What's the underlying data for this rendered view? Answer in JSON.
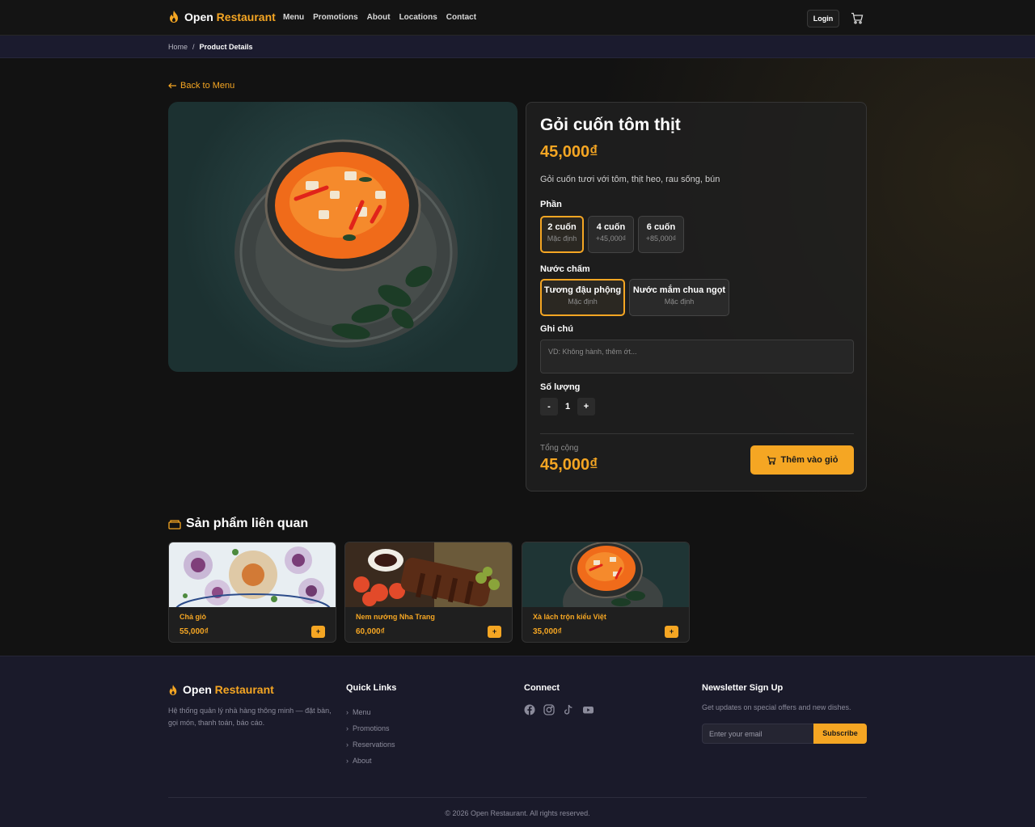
{
  "header": {
    "brand_part1": "Open",
    "brand_part2": "Restaurant",
    "nav": [
      "Menu",
      "Promotions",
      "About",
      "Locations",
      "Contact"
    ],
    "login_label": "Login",
    "cart_icon": "cart-icon"
  },
  "breadcrumb": {
    "home": "Home",
    "separator": "/",
    "current": "Product Details"
  },
  "back_link": "Back to Menu",
  "product": {
    "name": "Gỏi cuốn tôm thịt",
    "price": "45,000₫",
    "description": "Gỏi cuốn tươi với tôm, thịt heo, rau sống, bún",
    "portion_label": "Phần",
    "portions": [
      {
        "name": "2 cuốn",
        "sub": "Mặc định",
        "selected": true
      },
      {
        "name": "4 cuốn",
        "sub": "+45,000₫",
        "selected": false
      },
      {
        "name": "6 cuốn",
        "sub": "+85,000₫",
        "selected": false
      }
    ],
    "sauce_label": "Nước chấm",
    "sauces": [
      {
        "name": "Tương đậu phộng",
        "sub": "Mặc định",
        "selected": true
      },
      {
        "name": "Nước mắm chua ngọt",
        "sub": "Mặc định",
        "selected": false
      }
    ],
    "note_label": "Ghi chú",
    "note_placeholder": "VD: Không hành, thêm ớt...",
    "qty_label": "Số lượng",
    "qty_minus": "-",
    "qty_value": "1",
    "qty_plus": "+",
    "total_label": "Tổng cộng",
    "total_value": "45,000₫",
    "add_to_cart": "Thêm vào giỏ"
  },
  "related": {
    "title": "Sản phẩm liên quan",
    "items": [
      {
        "name": "Chả giò",
        "price": "55,000₫",
        "add": "+"
      },
      {
        "name": "Nem nướng Nha Trang",
        "price": "60,000₫",
        "add": "+"
      },
      {
        "name": "Xà lách trộn kiểu Việt",
        "price": "35,000₫",
        "add": "+"
      }
    ]
  },
  "footer": {
    "brand_part1": "Open",
    "brand_part2": "Restaurant",
    "description": "Hệ thống quản lý nhà hàng thông minh — đặt bàn, gọi món, thanh toán, báo cáo.",
    "quick_links_title": "Quick Links",
    "quick_links": [
      "Menu",
      "Promotions",
      "Reservations",
      "About"
    ],
    "connect_title": "Connect",
    "social_icons": [
      "facebook-icon",
      "instagram-icon",
      "tiktok-icon",
      "youtube-icon"
    ],
    "newsletter_title": "Newsletter Sign Up",
    "newsletter_text": "Get updates on special offers and new dishes.",
    "email_placeholder": "Enter your email",
    "subscribe_label": "Subscribe",
    "copyright": "© 2026 Open Restaurant. All rights reserved."
  },
  "colors": {
    "accent": "#f5a623",
    "background": "#121212",
    "footer_bg": "#1a1a2a"
  }
}
